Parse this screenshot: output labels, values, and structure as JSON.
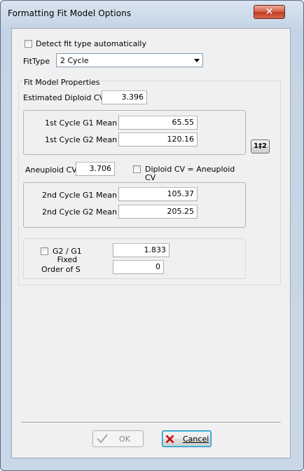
{
  "window": {
    "title": "Formatting Fit Model Options",
    "close_glyph": "✕"
  },
  "detect": {
    "label": "Detect fit type automatically",
    "checked": false
  },
  "fit_type": {
    "label": "FitType",
    "value": "2 Cycle"
  },
  "properties": {
    "group_label": "Fit Model Properties",
    "diploid_cv_label": "Estimated Diploid CV",
    "diploid_cv_value": "3.396",
    "cycle1_g1_label": "1st Cycle G1 Mean",
    "cycle1_g1_value": "65.55",
    "cycle1_g2_label": "1st Cycle G2 Mean",
    "cycle1_g2_value": "120.16",
    "swap_label": "1‡2",
    "aneuploid_cv_label": "Aneuploid CV",
    "aneuploid_cv_value": "3.706",
    "diploid_eq_label_line1": "Diploid CV = Aneuploid",
    "diploid_eq_label_line2": "CV",
    "cycle2_g1_label": "2nd Cycle G1 Mean",
    "cycle2_g1_value": "105.37",
    "cycle2_g2_label": "2nd Cycle G2 Mean",
    "cycle2_g2_value": "205.25",
    "g2g1_label_line1": "G2 / G1",
    "g2g1_label_line2": "Fixed",
    "g2g1_value": "1.833",
    "order_s_label": "Order of S",
    "order_s_value": "0"
  },
  "buttons": {
    "ok": "OK",
    "cancel": "Cancel"
  },
  "colors": {
    "frame": "#c9d7e6",
    "panel": "#f0f0f0",
    "close": "#c2381f"
  }
}
